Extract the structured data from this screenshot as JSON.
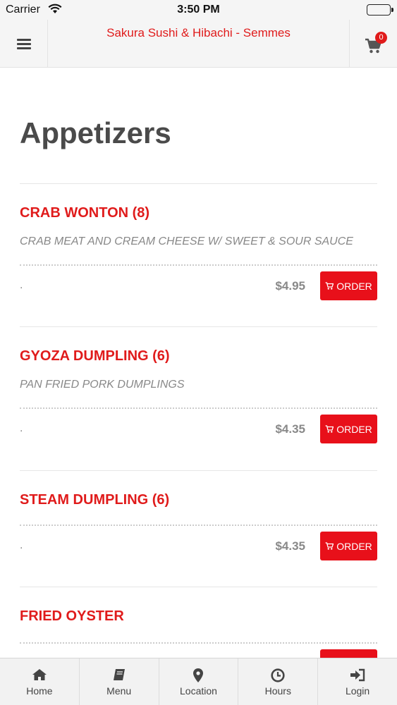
{
  "status_bar": {
    "carrier": "Carrier",
    "time": "3:50 PM"
  },
  "header": {
    "title": "Sakura Sushi & Hibachi - Semmes",
    "cart_count": "0"
  },
  "page_title": "Appetizers",
  "items": [
    {
      "name": "CRAB WONTON (8)",
      "description": "CRAB MEAT AND CREAM CHEESE W/ SWEET & SOUR SAUCE",
      "note": ".",
      "price": "$4.95",
      "order_label": "ORDER"
    },
    {
      "name": "GYOZA DUMPLING (6)",
      "description": "PAN FRIED PORK DUMPLINGS",
      "note": ".",
      "price": "$4.35",
      "order_label": "ORDER"
    },
    {
      "name": "STEAM DUMPLING (6)",
      "description": "",
      "note": ".",
      "price": "$4.35",
      "order_label": "ORDER"
    },
    {
      "name": "FRIED OYSTER",
      "description": "",
      "note": "",
      "price": "",
      "order_label": "ORDER"
    }
  ],
  "tabbar": [
    {
      "label": "Home",
      "icon": "home-icon"
    },
    {
      "label": "Menu",
      "icon": "book-icon"
    },
    {
      "label": "Location",
      "icon": "map-pin-icon"
    },
    {
      "label": "Hours",
      "icon": "clock-icon"
    },
    {
      "label": "Login",
      "icon": "sign-in-icon"
    }
  ],
  "colors": {
    "accent": "#e01b1b",
    "order_button": "#e8101a",
    "title_text": "#4a4a4a"
  }
}
